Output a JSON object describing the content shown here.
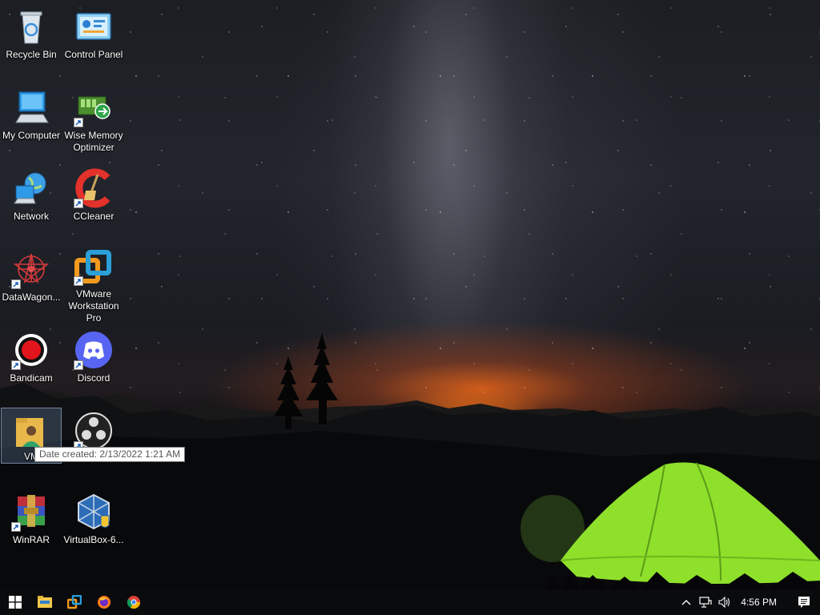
{
  "desktop": {
    "icons": [
      {
        "label": "Recycle Bin",
        "icon": "recycle-bin-icon"
      },
      {
        "label": "Control Panel",
        "icon": "control-panel-icon"
      },
      {
        "label": "My Computer",
        "icon": "computer-icon"
      },
      {
        "label": "Wise Memory Optimizer",
        "icon": "wise-memory-optimizer-icon"
      },
      {
        "label": "Network",
        "icon": "network-icon"
      },
      {
        "label": "CCleaner",
        "icon": "ccleaner-icon"
      },
      {
        "label": "DataWagon...",
        "icon": "datawagon-icon"
      },
      {
        "label": "VMware Workstation Pro",
        "icon": "vmware-icon"
      },
      {
        "label": "Bandicam",
        "icon": "bandicam-icon"
      },
      {
        "label": "Discord",
        "icon": "discord-icon"
      },
      {
        "label": "VM",
        "icon": "folder-user-icon"
      },
      {
        "label": "",
        "icon": "obs-studio-icon"
      },
      {
        "label": "WinRAR",
        "icon": "winrar-icon"
      },
      {
        "label": "VirtualBox-6...",
        "icon": "virtualbox-icon"
      }
    ],
    "tooltip": "Date created: 2/13/2022 1:21 AM"
  },
  "taskbar": {
    "pinned": [
      "start-icon",
      "file-explorer-icon",
      "vmware-icon",
      "firefox-icon",
      "chrome-icon"
    ],
    "tray_icons": [
      "chevron-up-icon",
      "network-icon",
      "volume-icon"
    ],
    "clock": "4:56 PM",
    "notification_icon": "notification-icon"
  },
  "colors": {
    "taskbar": "#0a0b0d",
    "selection": "#7896be",
    "tent": "#8fe02b"
  }
}
